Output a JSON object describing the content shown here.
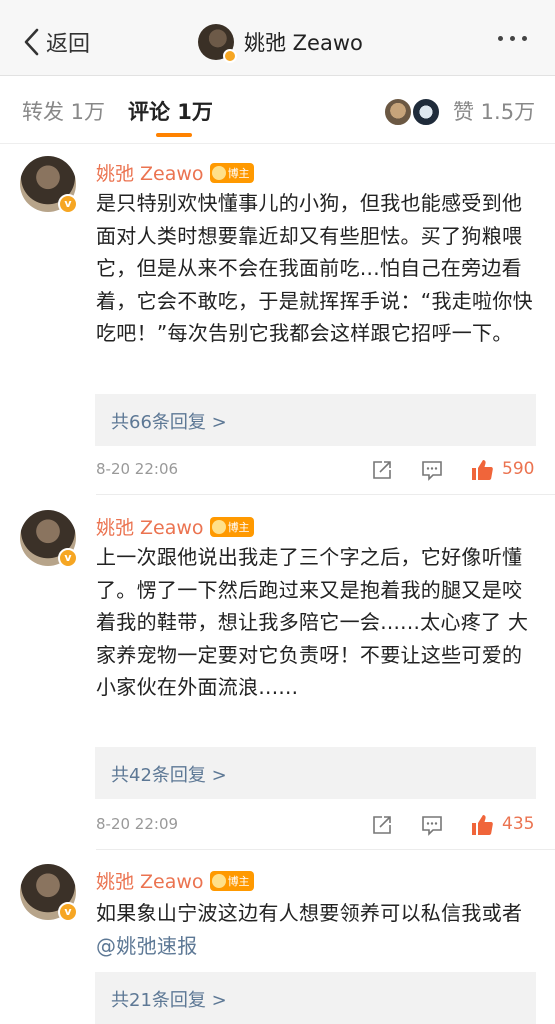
{
  "nav": {
    "back_label": "返回",
    "title": "姚弛 Zeawo"
  },
  "tabs": {
    "repost": "转发 1万",
    "comment": "评论 1万",
    "like": "赞 1.5万"
  },
  "comments": [
    {
      "name": "姚弛 Zeawo",
      "badge": "博主",
      "text": "是只特别欢快懂事儿的小狗，但我也能感受到他面对人类时想要靠近却又有些胆怯。买了狗粮喂它，但是从来不会在我面前吃...怕自己在旁边看着，它会不敢吃，于是就挥挥手说：“我走啦你快吃吧！”每次告别它我都会这样跟它招呼一下。",
      "replies": "共66条回复 >",
      "time": "8-20 22:06",
      "likes": "590"
    },
    {
      "name": "姚弛 Zeawo",
      "badge": "博主",
      "text": "上一次跟他说出我走了三个字之后，它好像听懂了。愣了一下然后跑过来又是抱着我的腿又是咬着我的鞋带，想让我多陪它一会......太心疼了 大家养宠物一定要对它负责呀！不要让这些可爱的小家伙在外面流浪......",
      "replies": "共42条回复 >",
      "time": "8-20 22:09",
      "likes": "435"
    },
    {
      "name": "姚弛 Zeawo",
      "badge": "博主",
      "text_prefix": "如果象山宁波这边有人想要领养可以私信我或者 ",
      "mention": "@姚弛速报",
      "replies": "共21条回复 >"
    }
  ],
  "colors": {
    "accent": "#ff8200",
    "name": "#eb7350",
    "link": "#5d7895",
    "verified": "#f6a623"
  },
  "icons": [
    "chevron-left-icon",
    "more-icon",
    "verified-icon",
    "vip-crown-icon",
    "share-icon",
    "comment-icon",
    "like-icon"
  ]
}
